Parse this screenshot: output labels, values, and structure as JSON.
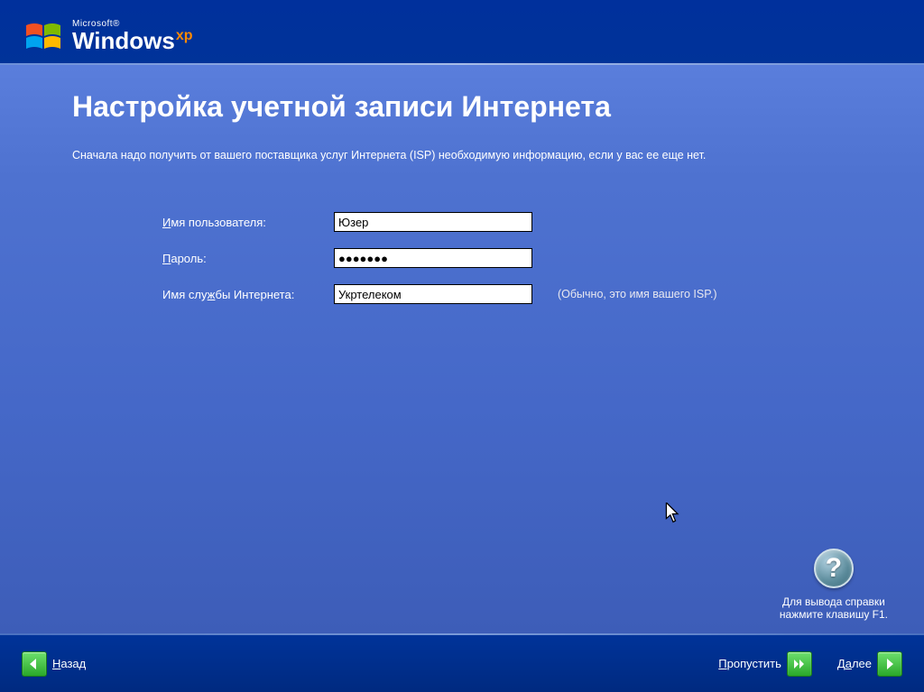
{
  "header": {
    "microsoft": "Microsoft®",
    "windows": "Windows",
    "xp": "xp"
  },
  "main": {
    "title": "Настройка учетной записи Интернета",
    "subtitle": "Сначала надо получить от вашего поставщика услуг Интернета (ISP) необходимую информацию, если у вас ее еще нет.",
    "form": {
      "username_label_pre": "И",
      "username_label_rest": "мя пользователя:",
      "username_value": "Юзер",
      "password_label_pre": "П",
      "password_label_rest": "ароль:",
      "password_value": "●●●●●●●",
      "isp_label_pre": "Имя слу",
      "isp_label_underline": "ж",
      "isp_label_rest": "бы Интернета:",
      "isp_value": "Укртелеком",
      "isp_hint": "(Обычно, это имя вашего ISP.)"
    },
    "help": {
      "line1": "Для вывода справки",
      "line2": "нажмите клавишу F1."
    }
  },
  "footer": {
    "back_underline": "Н",
    "back_rest": "азад",
    "skip_underline": "П",
    "skip_rest": "ропустить",
    "next_pre": "Д",
    "next_underline": "а",
    "next_rest": "лее"
  }
}
